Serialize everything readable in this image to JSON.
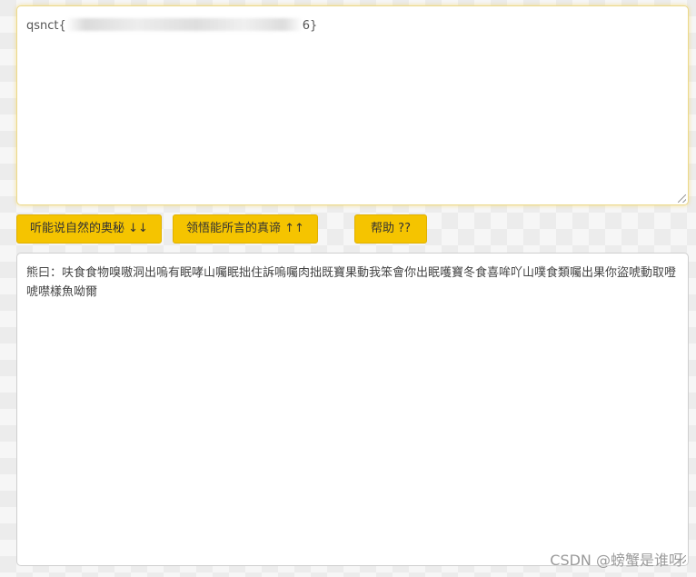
{
  "input": {
    "text_start": "qsnct{",
    "text_end": "6}"
  },
  "buttons": {
    "listen": "听能说自然的奥秘 ↓↓",
    "comprehend": "领悟能所言的真谛 ↑↑",
    "help": "帮助 ??"
  },
  "output": {
    "text": "熊曰：呋食食物嗅嗷洞出嗚有眠哮山囑眠拙住訴嗚囑肉拙既寶果動我笨會你出眠嚄寶冬食喜哞吖山噗食類囑出果你盜唬動取噔唬噤樣魚呦爾"
  },
  "watermark": "CSDN @螃蟹是谁呀"
}
